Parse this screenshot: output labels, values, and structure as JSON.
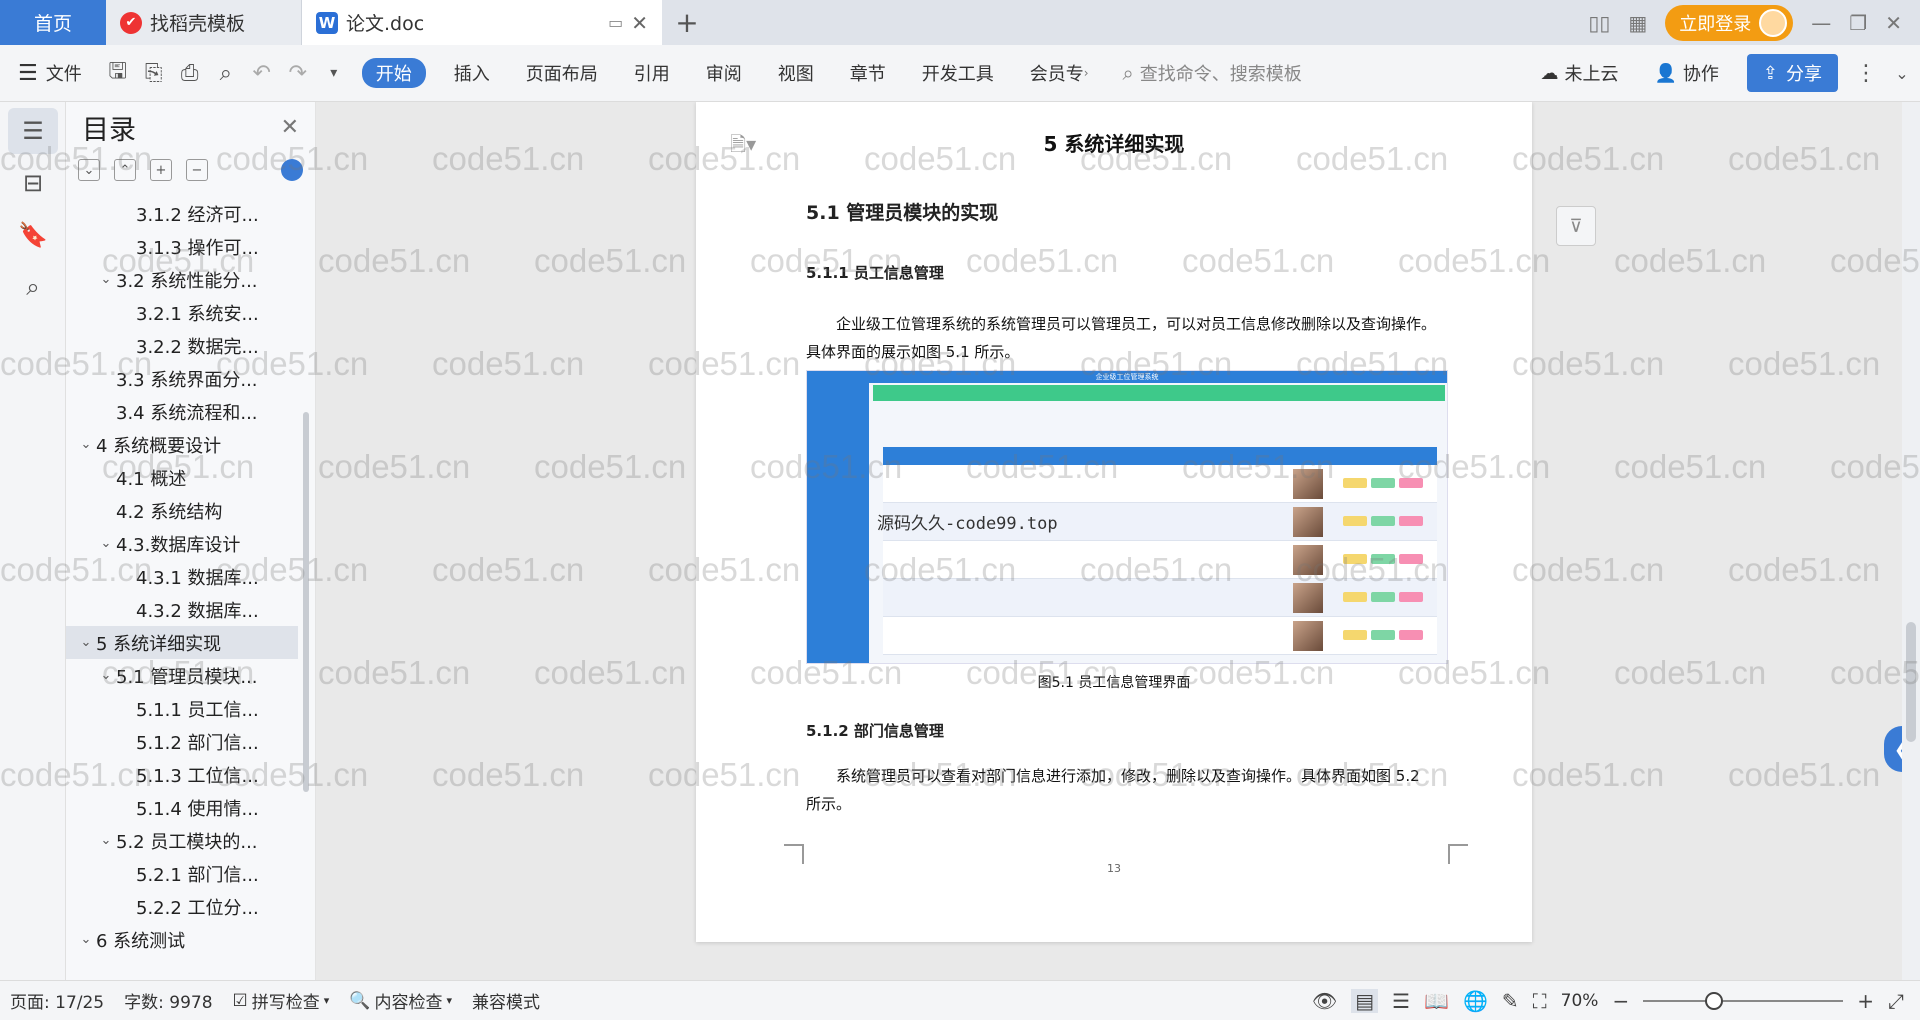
{
  "tabs": {
    "home": "首页",
    "daoke": "找稻壳模板",
    "doc": "论文.doc",
    "login": "立即登录"
  },
  "ribbon": {
    "file": "文件",
    "start": "开始",
    "insert": "插入",
    "layout": "页面布局",
    "reference": "引用",
    "review": "审阅",
    "view": "视图",
    "chapter": "章节",
    "devtools": "开发工具",
    "member": "会员专",
    "search_placeholder": "查找命令、搜索模板",
    "cloud": "未上云",
    "collab": "协作",
    "share": "分享"
  },
  "toc": {
    "title": "目录",
    "items": [
      {
        "label": "3.1.2 经济可...",
        "level": 3,
        "caret": ""
      },
      {
        "label": "3.1.3 操作可...",
        "level": 3,
        "caret": ""
      },
      {
        "label": "3.2 系统性能分...",
        "level": 2,
        "caret": "v"
      },
      {
        "label": "3.2.1  系统安...",
        "level": 3,
        "caret": ""
      },
      {
        "label": "3.2.2  数据完...",
        "level": 3,
        "caret": ""
      },
      {
        "label": "3.3 系统界面分...",
        "level": 2,
        "caret": ""
      },
      {
        "label": "3.4 系统流程和...",
        "level": 2,
        "caret": ""
      },
      {
        "label": "4 系统概要设计",
        "level": 1,
        "caret": "v"
      },
      {
        "label": "4.1 概述",
        "level": 2,
        "caret": ""
      },
      {
        "label": "4.2 系统结构",
        "level": 2,
        "caret": ""
      },
      {
        "label": "4.3.数据库设计",
        "level": 2,
        "caret": "v"
      },
      {
        "label": "4.3.1 数据库...",
        "level": 3,
        "caret": ""
      },
      {
        "label": "4.3.2 数据库...",
        "level": 3,
        "caret": ""
      },
      {
        "label": "5 系统详细实现",
        "level": 1,
        "caret": "v",
        "selected": true
      },
      {
        "label": "5.1  管理员模块...",
        "level": 2,
        "caret": "v"
      },
      {
        "label": "5.1.1  员工信...",
        "level": 3,
        "caret": ""
      },
      {
        "label": "5.1.2  部门信...",
        "level": 3,
        "caret": ""
      },
      {
        "label": "5.1.3  工位信...",
        "level": 3,
        "caret": ""
      },
      {
        "label": "5.1.4  使用情...",
        "level": 3,
        "caret": ""
      },
      {
        "label": "5.2  员工模块的...",
        "level": 2,
        "caret": "v"
      },
      {
        "label": "5.2.1  部门信...",
        "level": 3,
        "caret": ""
      },
      {
        "label": "5.2.2  工位分...",
        "level": 3,
        "caret": ""
      },
      {
        "label": "6 系统测试",
        "level": 1,
        "caret": "v"
      }
    ]
  },
  "doc": {
    "h1": "5 系统详细实现",
    "h2": "5.1  管理员模块的实现",
    "h3_1": "5.1.1  员工信息管理",
    "p1": "企业级工位管理系统的系统管理员可以管理员工，可以对员工信息修改删除以及查询操作。具体界面的展示如图 5.1 所示。",
    "fig_title": "企业级工位管理系统",
    "fig_overlay": "源码久久-code99.top",
    "caption": "图5.1  员工信息管理界面",
    "h3_2": "5.1.2  部门信息管理",
    "p2": "系统管理员可以查看对部门信息进行添加，修改，删除以及查询操作。具体界面如图 5.2 所示。",
    "page_number": "13"
  },
  "watermark": "code51.cn",
  "status": {
    "page": "页面: 17/25",
    "words": "字数: 9978",
    "spell": "拼写检查",
    "content": "内容检查",
    "compat": "兼容模式",
    "zoom": "70%"
  },
  "colors": {
    "accent": "#3a7bd5",
    "login": "#f39c12"
  }
}
